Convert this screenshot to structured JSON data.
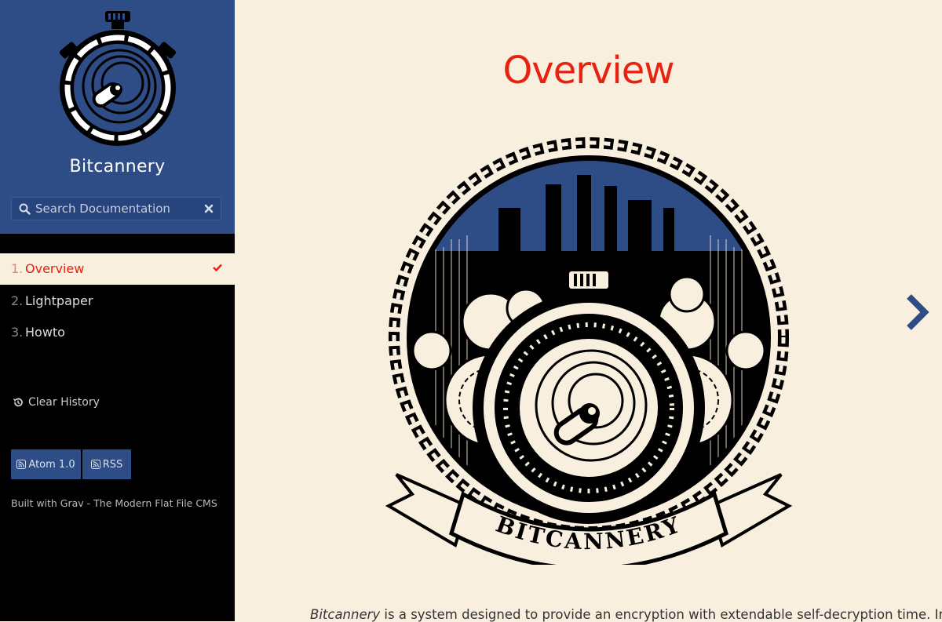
{
  "site": {
    "title": "Bitcannery",
    "brand_color": "#2e4c86",
    "accent_color": "#e62310"
  },
  "search": {
    "placeholder": "Search Documentation"
  },
  "nav": [
    {
      "num": "1.",
      "label": "Overview",
      "active": true
    },
    {
      "num": "2.",
      "label": "Lightpaper",
      "active": false
    },
    {
      "num": "3.",
      "label": "Howto",
      "active": false
    }
  ],
  "sidebar": {
    "clear_history": "Clear History",
    "feeds": [
      {
        "label": "Atom 1.0",
        "icon": "rss-icon"
      },
      {
        "label": "RSS",
        "icon": "rss-icon"
      }
    ],
    "built_with": "Built with Grav - The Modern Flat File CMS"
  },
  "main": {
    "title": "Overview",
    "hero_banner": "BITCANNERY",
    "intro_em": "Bitcannery",
    "intro_rest": " is a system designed to provide an encryption with extendable self-decryption time. In"
  }
}
